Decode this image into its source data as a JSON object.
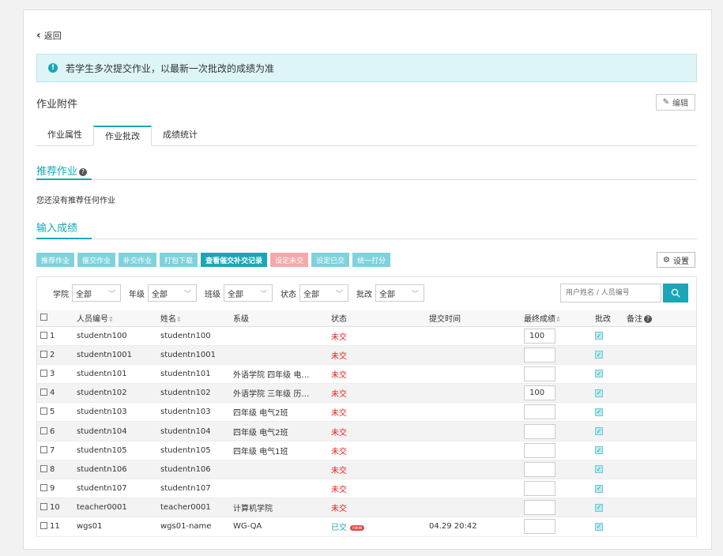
{
  "back_label": "返回",
  "notice": "若学生多次提交作业，以最新一次批改的成绩为准",
  "section_title": "作业附件",
  "edit_label": "编辑",
  "tabs": [
    {
      "label": "作业属性",
      "active": false
    },
    {
      "label": "作业批改",
      "active": true
    },
    {
      "label": "成绩统计",
      "active": false
    }
  ],
  "recommended": {
    "title": "推荐作业",
    "empty": "您还没有推荐任何作业"
  },
  "scores_title": "输入成绩",
  "actions": [
    {
      "label": "推荐作业",
      "style": "light"
    },
    {
      "label": "催交作业",
      "style": "light"
    },
    {
      "label": "补交作业",
      "style": "light"
    },
    {
      "label": "打包下载",
      "style": "light"
    },
    {
      "label": "查看催交补交记录",
      "style": "dark"
    },
    {
      "label": "设定未交",
      "style": "pink"
    },
    {
      "label": "设定已交",
      "style": "light"
    },
    {
      "label": "统一打分",
      "style": "light"
    }
  ],
  "settings_label": "设置",
  "filters": [
    {
      "label": "学院",
      "value": "全部"
    },
    {
      "label": "年级",
      "value": "全部"
    },
    {
      "label": "班级",
      "value": "全部"
    },
    {
      "label": "状态",
      "value": "全部"
    },
    {
      "label": "批改",
      "value": "全部"
    }
  ],
  "search_placeholder": "用户姓名 / 人员编号",
  "columns": {
    "id": "人员编号",
    "name": "姓名",
    "dept": "系级",
    "status": "状态",
    "time": "提交时间",
    "score": "最终成绩",
    "graded": "批改",
    "note": "备注"
  },
  "rows": [
    {
      "n": "1",
      "id": "studentn100",
      "name": "studentn100",
      "dept": "",
      "status": "未交",
      "submitted": false,
      "time": "",
      "score": "100"
    },
    {
      "n": "2",
      "id": "studentn1001",
      "name": "studentn1001",
      "dept": "",
      "status": "未交",
      "submitted": false,
      "time": "",
      "score": ""
    },
    {
      "n": "3",
      "id": "studentn101",
      "name": "studentn101",
      "dept": "外语学院 四年级 电…",
      "status": "未交",
      "submitted": false,
      "time": "",
      "score": ""
    },
    {
      "n": "4",
      "id": "studentn102",
      "name": "studentn102",
      "dept": "外语学院 三年级 历…",
      "status": "未交",
      "submitted": false,
      "time": "",
      "score": "100"
    },
    {
      "n": "5",
      "id": "studentn103",
      "name": "studentn103",
      "dept": "四年级 电气2班",
      "status": "未交",
      "submitted": false,
      "time": "",
      "score": ""
    },
    {
      "n": "6",
      "id": "studentn104",
      "name": "studentn104",
      "dept": "四年级 电气2班",
      "status": "未交",
      "submitted": false,
      "time": "",
      "score": ""
    },
    {
      "n": "7",
      "id": "studentn105",
      "name": "studentn105",
      "dept": "四年级 电气1班",
      "status": "未交",
      "submitted": false,
      "time": "",
      "score": ""
    },
    {
      "n": "8",
      "id": "studentn106",
      "name": "studentn106",
      "dept": "",
      "status": "未交",
      "submitted": false,
      "time": "",
      "score": ""
    },
    {
      "n": "9",
      "id": "studentn107",
      "name": "studentn107",
      "dept": "",
      "status": "未交",
      "submitted": false,
      "time": "",
      "score": ""
    },
    {
      "n": "10",
      "id": "teacher0001",
      "name": "teacher0001",
      "dept": "计算机学院",
      "status": "未交",
      "submitted": false,
      "time": "",
      "score": ""
    },
    {
      "n": "11",
      "id": "wgs01",
      "name": "wgs01-name",
      "dept": "WG-QA",
      "status": "已交",
      "submitted": true,
      "new_tag": "new",
      "time": "04.29 20:42",
      "score": ""
    }
  ],
  "colors": {
    "accent": "#1aa6b7",
    "danger": "#e02020"
  }
}
